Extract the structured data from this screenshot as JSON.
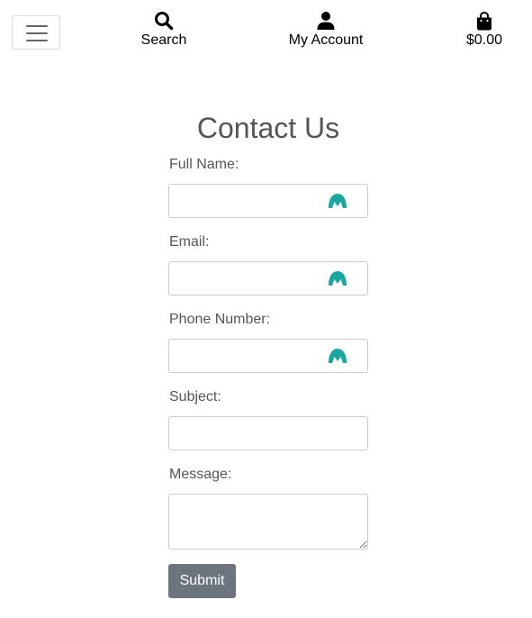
{
  "nav": {
    "menu_icon": "hamburger-icon",
    "search": {
      "icon": "search-icon",
      "label": "Search"
    },
    "account": {
      "icon": "user-icon",
      "label": "My Account"
    },
    "cart": {
      "icon": "shopping-bag-icon",
      "label": "$0.00"
    }
  },
  "form": {
    "title": "Contact Us",
    "fields": [
      {
        "label": "Full Name:",
        "value": "",
        "placeholder": "",
        "autofill_icon": true
      },
      {
        "label": "Email:",
        "value": "",
        "placeholder": "",
        "autofill_icon": true
      },
      {
        "label": "Phone Number:",
        "value": "",
        "placeholder": "",
        "autofill_icon": true
      },
      {
        "label": "Subject:",
        "value": "",
        "placeholder": "",
        "autofill_icon": false
      },
      {
        "label": "Message:",
        "value": "",
        "placeholder": "",
        "autofill_icon": false
      }
    ],
    "submit_label": "Submit"
  },
  "colors": {
    "autofill_icon": "#1aa7a0",
    "submit_bg": "#6c757d",
    "text": "#555555"
  }
}
